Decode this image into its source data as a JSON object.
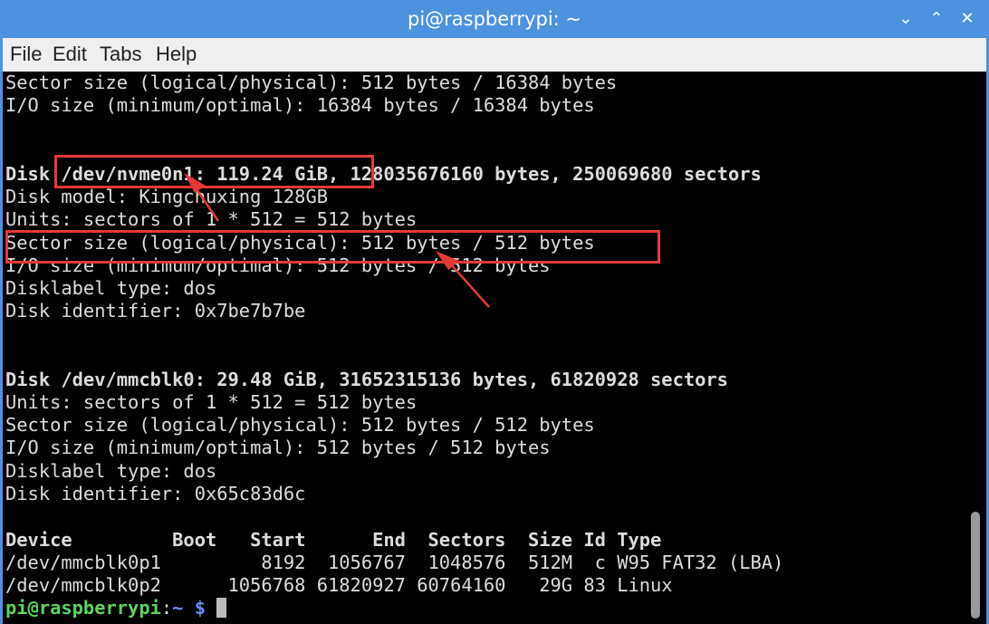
{
  "window": {
    "title": "pi@raspberrypi: ~"
  },
  "menu": [
    "File",
    "Edit",
    "Tabs",
    "Help"
  ],
  "terminal": {
    "lines": [
      "Sector size (logical/physical): 512 bytes / 16384 bytes",
      "I/O size (minimum/optimal): 16384 bytes / 16384 bytes",
      "Disk /dev/nvme0n1: 119.24 GiB, 128035676160 bytes, 250069680 sectors",
      "Disk model: Kingchuxing 128GB",
      "Units: sectors of 1 * 512 = 512 bytes",
      "Sector size (logical/physical): 512 bytes / 512 bytes",
      "I/O size (minimum/optimal): 512 bytes / 512 bytes",
      "Disklabel type: dos",
      "Disk identifier: 0x7be7b7be",
      "Disk /dev/mmcblk0: 29.48 GiB, 31652315136 bytes, 61820928 sectors",
      "Units: sectors of 1 * 512 = 512 bytes",
      "Sector size (logical/physical): 512 bytes / 512 bytes",
      "I/O size (minimum/optimal): 512 bytes / 512 bytes",
      "Disklabel type: dos",
      "Disk identifier: 0x65c83d6c",
      "Device         Boot   Start      End  Sectors  Size Id Type",
      "/dev/mmcblk0p1         8192  1056767  1048576  512M  c W95 FAT32 (LBA)",
      "/dev/mmcblk0p2      1056768 61820927 60764160   29G 83 Linux"
    ],
    "prompt": {
      "user_host": "pi@raspberrypi",
      "separator": ":",
      "path": "~ ",
      "symbol": "$ "
    }
  },
  "colors": {
    "titlebar": "#4d92df",
    "terminal_bg": "#000000",
    "terminal_fg": "#dcdcdc",
    "prompt_user": "#5cd35c",
    "prompt_path": "#6b8cff",
    "annotation": "#e53935"
  }
}
